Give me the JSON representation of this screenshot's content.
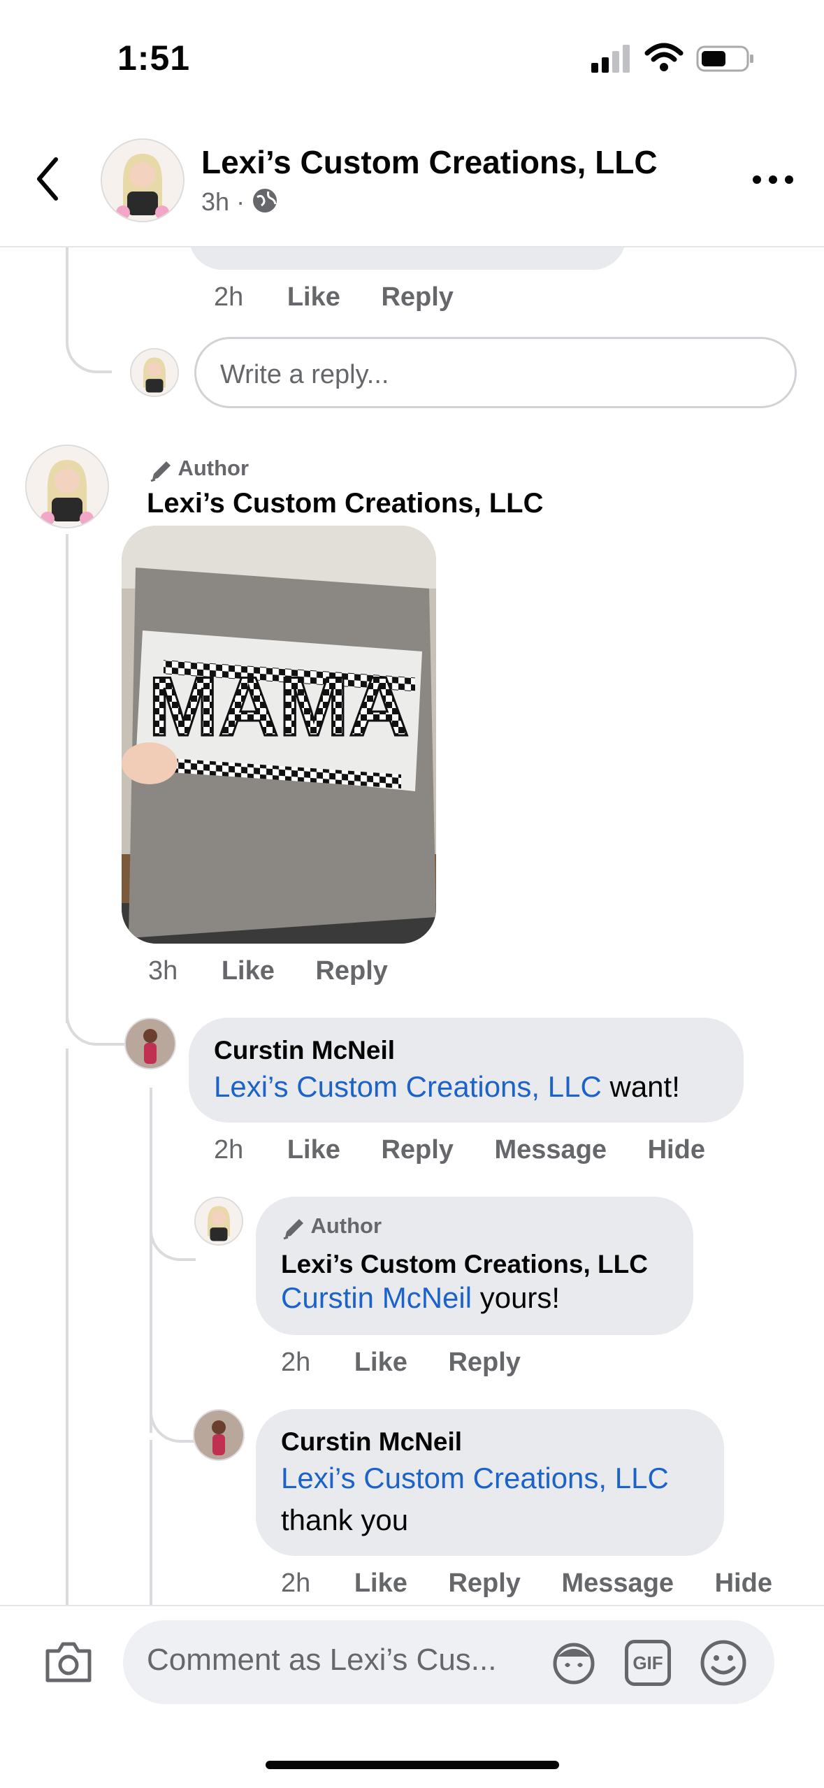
{
  "status_bar": {
    "time": "1:51"
  },
  "header": {
    "page_name": "Lexi’s Custom Creations, LLC",
    "time": "3h",
    "dot": "·"
  },
  "prev_reply": {
    "time": "2h",
    "like": "Like",
    "reply": "Reply"
  },
  "reply_box": {
    "placeholder": "Write a reply..."
  },
  "main_comment": {
    "badge": "Author",
    "author": "Lexi’s Custom Creations, LLC",
    "image_text": "MAMA",
    "time": "3h",
    "like": "Like",
    "reply": "Reply"
  },
  "replies": [
    {
      "author": "Curstin McNeil",
      "mention": "Lexi’s Custom Creations, LLC",
      "text": " want!",
      "time": "2h",
      "like": "Like",
      "reply": "Reply",
      "message": "Message",
      "hide": "Hide"
    },
    {
      "badge": "Author",
      "author": "Lexi’s Custom Creations, LLC",
      "mention": "Curstin McNeil",
      "text": " yours!",
      "time": "2h",
      "like": "Like",
      "reply": "Reply"
    },
    {
      "author": "Curstin McNeil",
      "mention": "Lexi’s Custom Creations, LLC",
      "text": "thank you",
      "time": "2h",
      "like": "Like",
      "reply": "Reply",
      "message": "Message",
      "hide": "Hide"
    }
  ],
  "composer": {
    "placeholder": "Comment as Lexi’s Cus...",
    "gif_label": "GIF",
    "icons": [
      "camera-icon",
      "avatar-sticker-icon",
      "gif-icon",
      "emoji-icon"
    ]
  },
  "colors": {
    "mention": "#1b63c9",
    "bubble": "#e9eaee",
    "secondary_text": "#65676b"
  }
}
